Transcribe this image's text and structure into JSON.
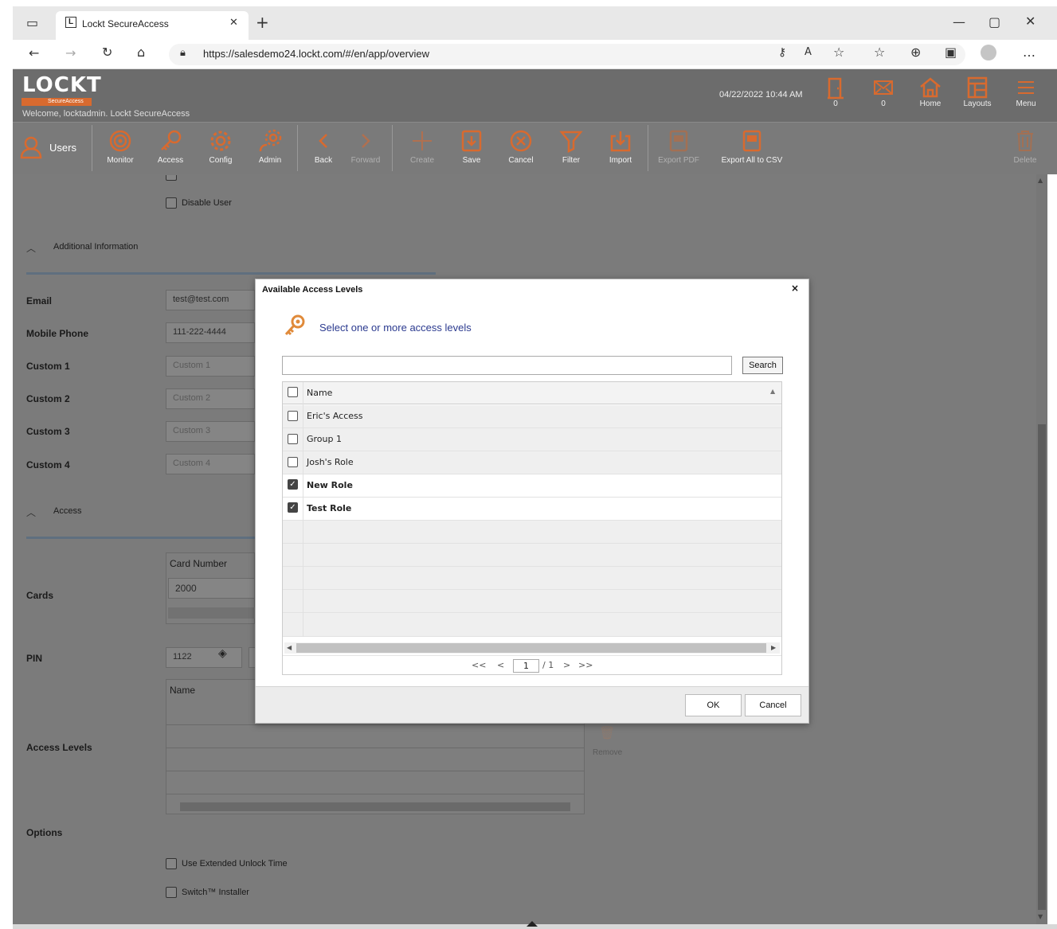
{
  "browser": {
    "tab_title": "Lockt SecureAccess",
    "url": "https://salesdemo24.lockt.com/#/en/app/overview",
    "new_tab_glyph": "+",
    "tab_close_glyph": "✕"
  },
  "app": {
    "logo": "LOCKT",
    "logo_sub": "SecureAccess",
    "welcome": "Welcome, locktadmin.  Lockt SecureAccess",
    "datetime": "04/22/2022 10:44 AM",
    "header_items": [
      {
        "label": "0",
        "icon": "door-icon"
      },
      {
        "label": "0",
        "icon": "mail-icon"
      },
      {
        "label": "Home",
        "icon": "home-icon"
      },
      {
        "label": "Layouts",
        "icon": "layouts-icon"
      },
      {
        "label": "Menu",
        "icon": "menu-icon"
      }
    ]
  },
  "toolbar": {
    "users": "Users",
    "monitor": "Monitor",
    "access": "Access",
    "config": "Config",
    "admin": "Admin",
    "back": "Back",
    "forward": "Forward",
    "create": "Create",
    "save": "Save",
    "cancel": "Cancel",
    "filter": "Filter",
    "import": "Import",
    "export_pdf": "Export PDF",
    "export_csv": "Export All to CSV",
    "delete": "Delete"
  },
  "form": {
    "disable_user": "Disable User",
    "section_additional": "Additional Information",
    "section_access": "Access",
    "fields": [
      {
        "label": "Email",
        "value": "test@test.com",
        "placeholder": false
      },
      {
        "label": "Mobile Phone",
        "value": "111-222-4444",
        "placeholder": false
      },
      {
        "label": "Custom 1",
        "value": "Custom 1",
        "placeholder": true
      },
      {
        "label": "Custom 2",
        "value": "Custom 2",
        "placeholder": true
      },
      {
        "label": "Custom 3",
        "value": "Custom 3",
        "placeholder": true
      },
      {
        "label": "Custom 4",
        "value": "Custom 4",
        "placeholder": true
      }
    ],
    "cards_label": "Cards",
    "card_number_header": "Card Number",
    "card_value": "2000",
    "pin_label": "PIN",
    "pin_value": "1122",
    "access_levels_label": "Access Levels",
    "access_name_header": "Name",
    "remove": "Remove",
    "options_label": "Options",
    "option_extended": "Use Extended Unlock Time",
    "option_installer": "Switch™ Installer"
  },
  "modal": {
    "title": "Available Access Levels",
    "close": "×",
    "heading": "Select one or more access levels",
    "search_value": "",
    "search_button": "Search",
    "column_name": "Name",
    "rows": [
      {
        "name": "Eric's Access",
        "checked": false
      },
      {
        "name": "Group 1",
        "checked": false
      },
      {
        "name": "Josh's Role",
        "checked": false
      },
      {
        "name": "New Role",
        "checked": true
      },
      {
        "name": "Test Role",
        "checked": true
      }
    ],
    "pager_first": "<<",
    "pager_prev": "<",
    "page": "1",
    "page_total": "/ 1",
    "pager_next": ">",
    "pager_last": ">>",
    "ok": "OK",
    "cancel": "Cancel"
  },
  "colors": {
    "accent_orange": "#d86a2f",
    "toolbar_gray": "#7a7a7a",
    "heading_blue": "#2b3a8f"
  }
}
